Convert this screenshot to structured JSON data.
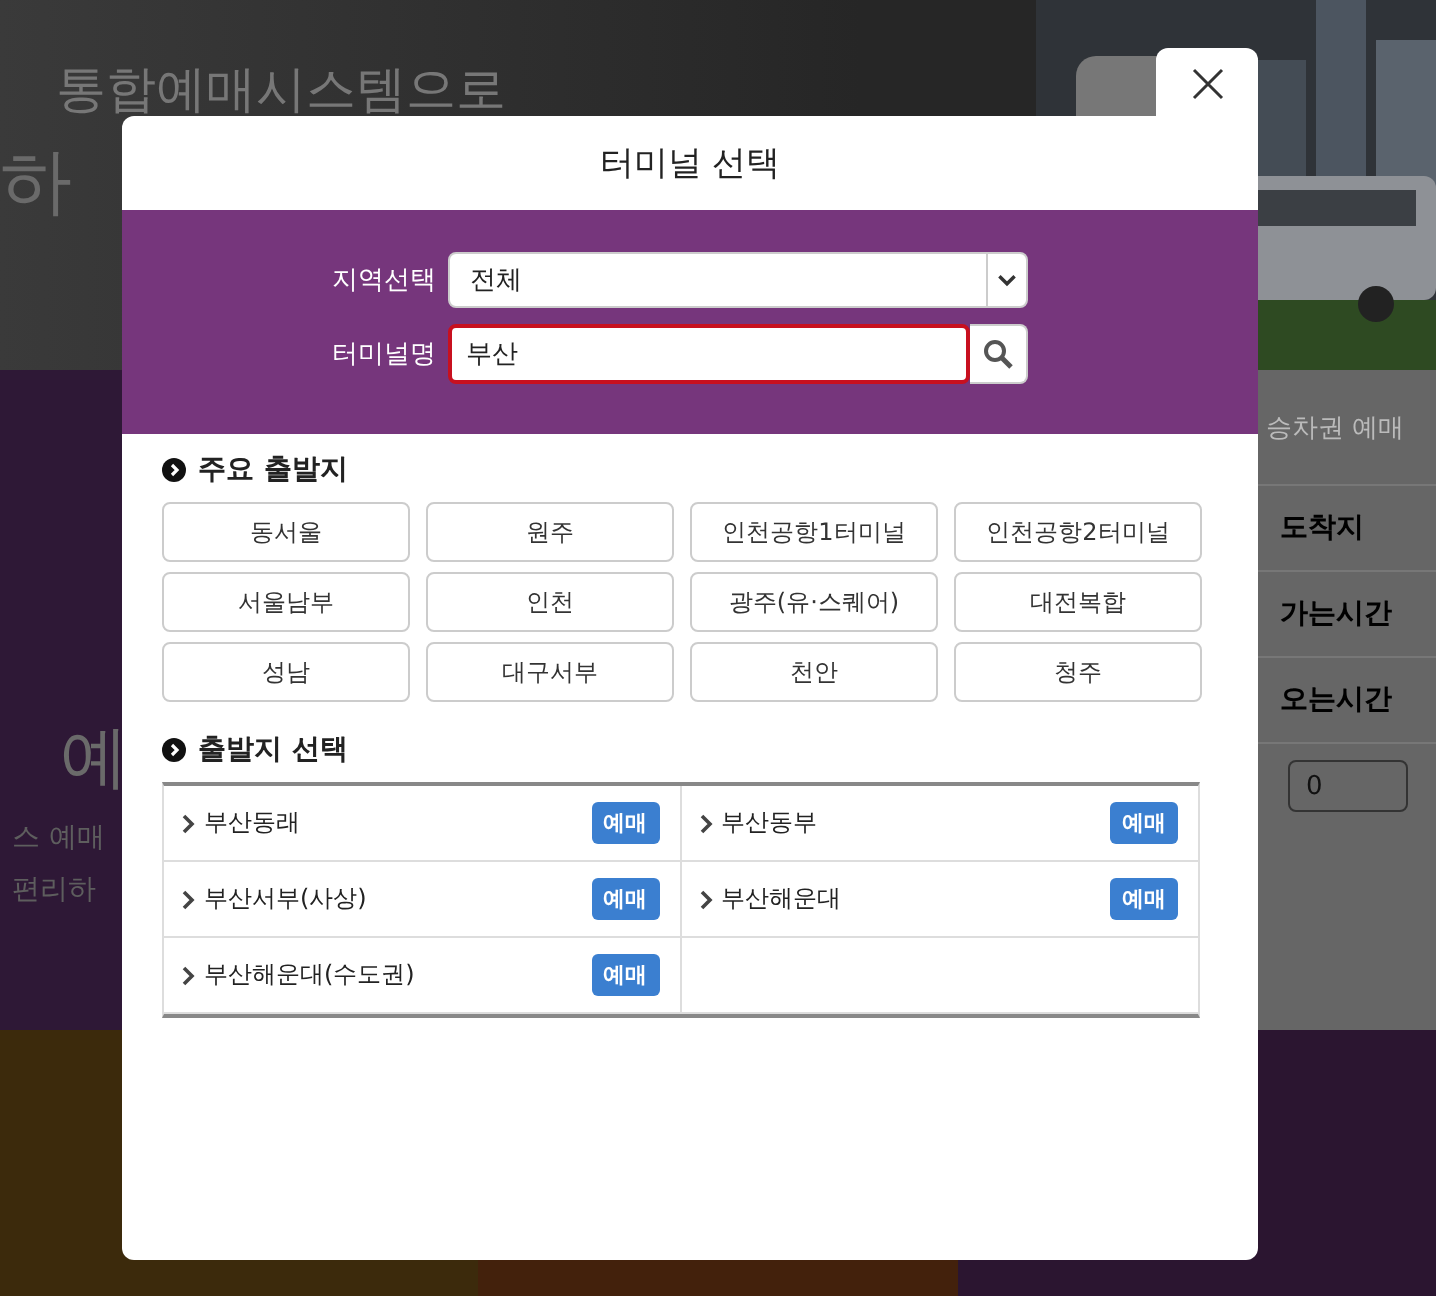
{
  "background": {
    "headline": "통합예매시스템으로",
    "headline_2": "하",
    "tab": "승차권 예매",
    "fields": [
      "도착지",
      "가는시간",
      "오는시간"
    ],
    "count_select": "0",
    "promo_title": "예",
    "promo_lines": [
      "스 예매",
      "편리하"
    ]
  },
  "dialog": {
    "title": "터미널 선택",
    "region": {
      "label": "지역선택",
      "value": "전체"
    },
    "terminal": {
      "label": "터미널명",
      "value": "부산",
      "focused": true
    },
    "major": {
      "heading": "주요 출발지",
      "items": [
        "동서울",
        "원주",
        "인천공항1터미널",
        "인천공항2터미널",
        "서울남부",
        "인천",
        "광주(유·스퀘어)",
        "대전복합",
        "성남",
        "대구서부",
        "천안",
        "청주"
      ]
    },
    "departures": {
      "heading": "출발지 선택",
      "items": [
        {
          "name": "부산동래",
          "action": "예매"
        },
        {
          "name": "부산동부",
          "action": "예매"
        },
        {
          "name": "부산서부(사상)",
          "action": "예매"
        },
        {
          "name": "부산해운대",
          "action": "예매"
        },
        {
          "name": "부산해운대(수도권)",
          "action": "예매"
        }
      ]
    }
  }
}
